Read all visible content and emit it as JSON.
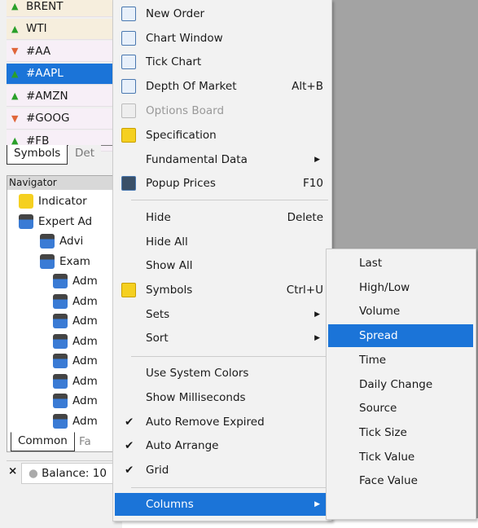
{
  "symbols": [
    {
      "name": "BRENT",
      "dir": "up"
    },
    {
      "name": "WTI",
      "dir": "up"
    },
    {
      "name": "#AA",
      "dir": "down"
    },
    {
      "name": "#AAPL",
      "dir": "up",
      "selected": true
    },
    {
      "name": "#AMZN",
      "dir": "up"
    },
    {
      "name": "#GOOG",
      "dir": "down"
    },
    {
      "name": "#FB",
      "dir": "up"
    }
  ],
  "symbol_tabs": [
    "Symbols",
    "Det"
  ],
  "navigator": {
    "title": "Navigator",
    "items": [
      "Indicator",
      "Expert Ad",
      "Advi",
      "Exam",
      "Adm",
      "Adm",
      "Adm",
      "Adm",
      "Adm",
      "Adm",
      "Adm",
      "Adm"
    ],
    "tabs": [
      "Common",
      "Fa"
    ]
  },
  "toolbox": {
    "close": "×",
    "balance": "Balance: 10"
  },
  "menu": {
    "items": [
      {
        "label": "New Order",
        "icon": "new-order-icon"
      },
      {
        "label": "Chart Window",
        "icon": "chart-window-icon"
      },
      {
        "label": "Tick Chart",
        "icon": "tick-chart-icon"
      },
      {
        "label": "Depth Of Market",
        "icon": "depth-of-market-icon",
        "shortcut": "Alt+B"
      },
      {
        "label": "Options Board",
        "icon": "options-board-icon",
        "disabled": true
      },
      {
        "label": "Specification",
        "icon": "specification-icon"
      },
      {
        "label": "Fundamental Data",
        "submenu": true
      },
      {
        "label": "Popup Prices",
        "icon": "popup-prices-icon",
        "shortcut": "F10"
      },
      {
        "label": "Hide",
        "shortcut": "Delete"
      },
      {
        "label": "Hide All"
      },
      {
        "label": "Show All"
      },
      {
        "label": "Symbols",
        "icon": "symbols-icon",
        "shortcut": "Ctrl+U"
      },
      {
        "label": "Sets",
        "submenu": true
      },
      {
        "label": "Sort",
        "submenu": true
      },
      {
        "label": "Use System Colors"
      },
      {
        "label": "Show Milliseconds"
      },
      {
        "label": "Auto Remove Expired",
        "checked": true
      },
      {
        "label": "Auto Arrange",
        "checked": true
      },
      {
        "label": "Grid",
        "checked": true
      },
      {
        "label": "Columns",
        "submenu": true,
        "highlighted": true
      }
    ]
  },
  "columns_submenu": {
    "items": [
      "Last",
      "High/Low",
      "Volume",
      "Spread",
      "Time",
      "Daily Change",
      "Source",
      "Tick Size",
      "Tick Value",
      "Face Value"
    ],
    "highlighted": "Spread"
  },
  "colors": {
    "highlight": "#1b74d8",
    "up": "#2aa02a",
    "down": "#e0663a"
  }
}
